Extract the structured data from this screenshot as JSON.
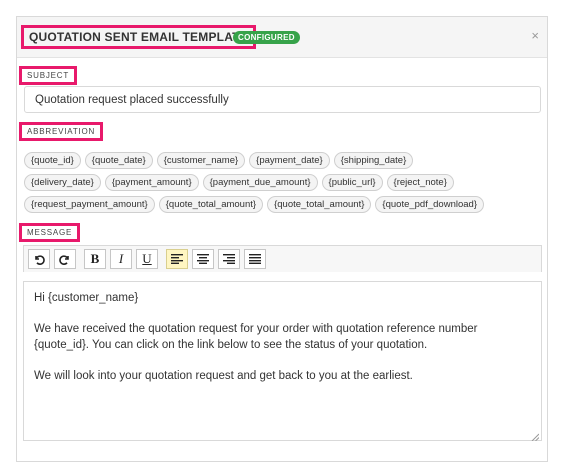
{
  "header": {
    "title": "QUOTATION SENT EMAIL TEMPLATE",
    "status_badge": "CONFIGURED",
    "close_glyph": "×"
  },
  "subject": {
    "label": "SUBJECT",
    "value": "Quotation request placed successfully"
  },
  "abbreviation": {
    "label": "ABBREVIATION",
    "chips": [
      "{quote_id}",
      "{quote_date}",
      "{customer_name}",
      "{payment_date}",
      "{shipping_date}",
      "{delivery_date}",
      "{payment_amount}",
      "{payment_due_amount}",
      "{public_url}",
      "{reject_note}",
      "{request_payment_amount}",
      "{quote_total_amount}",
      "{quote_total_amount}",
      "{quote_pdf_download}"
    ]
  },
  "message": {
    "label": "MESSAGE",
    "toolbar": {
      "undo_icon": "undo-icon",
      "redo_icon": "redo-icon",
      "bold": "B",
      "italic": "I",
      "underline": "U",
      "align_left_icon": "align-left-icon",
      "align_center_icon": "align-center-icon",
      "align_right_icon": "align-right-icon",
      "justify_icon": "justify-icon",
      "active_color": "#fff6c2"
    },
    "body": {
      "greeting": "Hi {customer_name}",
      "paragraph1": "We have received the quotation request for your order with quotation reference number {quote_id}. You can click on the link below to see the status of your quotation.",
      "paragraph2": "We will look into your quotation request and get back to you at the earliest."
    }
  },
  "colors": {
    "highlight": "#e8196b",
    "badge": "#37a34a"
  }
}
